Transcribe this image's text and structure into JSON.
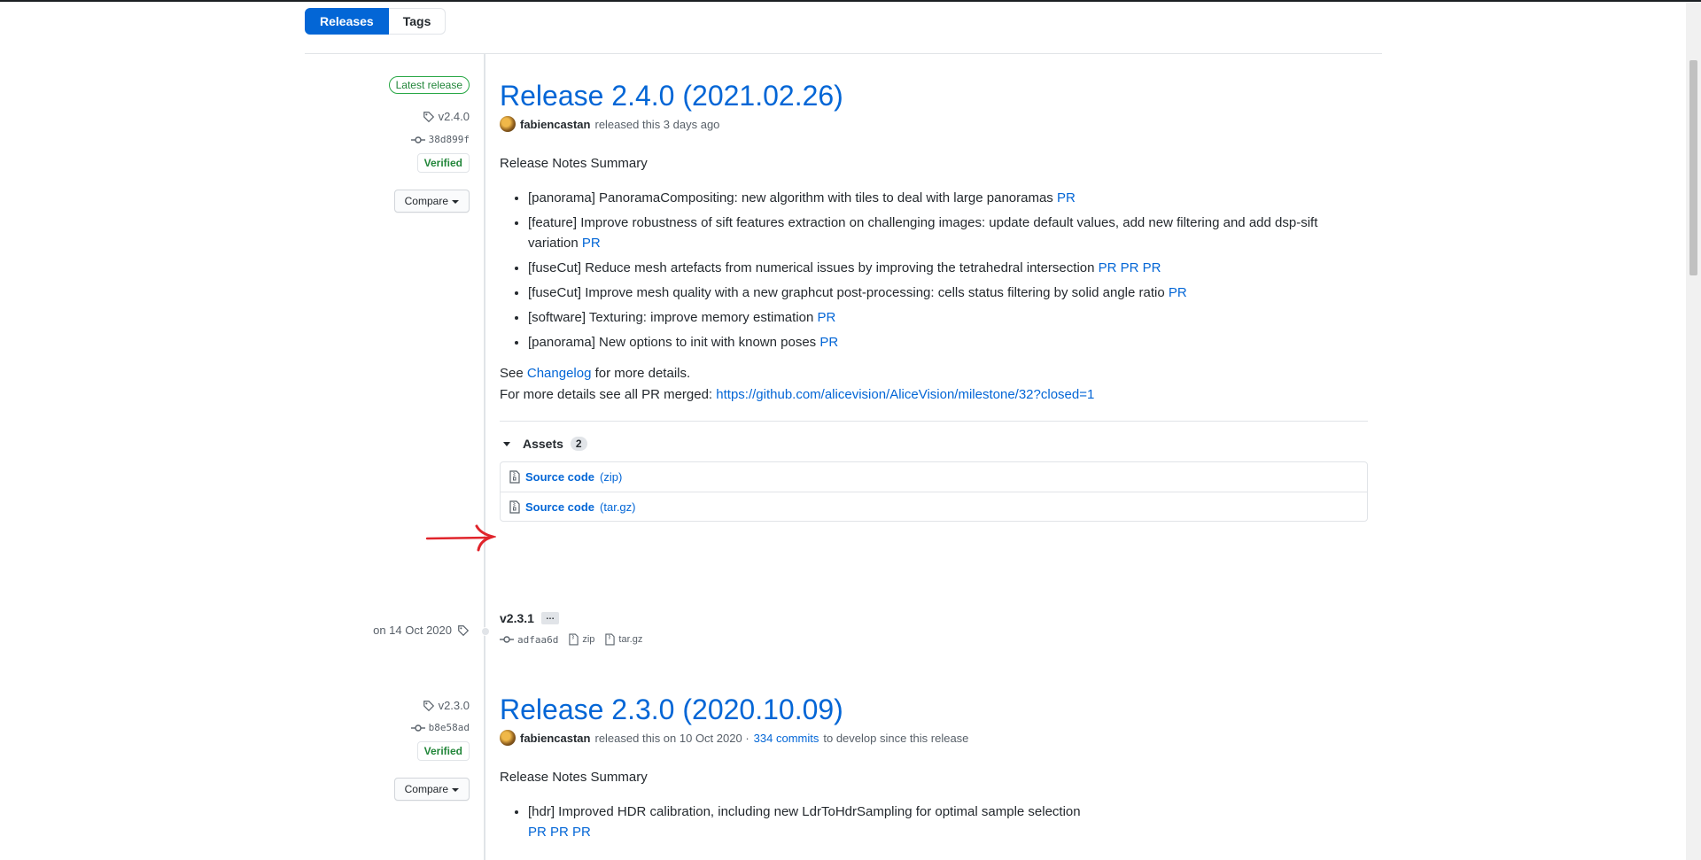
{
  "tabs": {
    "releases": "Releases",
    "tags": "Tags"
  },
  "release1": {
    "latest_badge": "Latest release",
    "tag": "v2.4.0",
    "commit": "38d899f",
    "verified": "Verified",
    "compare": "Compare",
    "title": "Release 2.4.0 (2021.02.26)",
    "author": "fabiencastan",
    "released_text": "released this 3 days ago",
    "summary_heading": "Release Notes Summary",
    "items": [
      {
        "text": "[panorama] PanoramaCompositing: new algorithm with tiles to deal with large panoramas",
        "links": [
          "PR"
        ]
      },
      {
        "text": "[feature] Improve robustness of sift features extraction on challenging images: update default values, add new filtering and add dsp-sift variation",
        "links": [
          "PR"
        ]
      },
      {
        "text": "[fuseCut] Reduce mesh artefacts from numerical issues by improving the tetrahedral intersection",
        "links": [
          "PR",
          "PR",
          "PR"
        ]
      },
      {
        "text": "[fuseCut] Improve mesh quality with a new graphcut post-processing: cells status filtering by solid angle ratio",
        "links": [
          "PR"
        ]
      },
      {
        "text": "[software] Texturing: improve memory estimation",
        "links": [
          "PR"
        ]
      },
      {
        "text": "[panorama] New options to init with known poses",
        "links": [
          "PR"
        ]
      }
    ],
    "see_prefix": "See",
    "changelog": "Changelog",
    "see_suffix": "for more details.",
    "more_prefix": "For more details see all PR merged:",
    "milestone_url": "https://github.com/alicevision/AliceVision/milestone/32?closed=1",
    "assets_label": "Assets",
    "assets_count": "2",
    "assets": [
      {
        "name": "Source code",
        "ext": "(zip)"
      },
      {
        "name": "Source code",
        "ext": "(tar.gz)"
      }
    ]
  },
  "tag_entry": {
    "date": "on 14 Oct 2020",
    "name": "v2.3.1",
    "ellipsis": "…",
    "commit": "adfaa6d",
    "zip": "zip",
    "targz": "tar.gz"
  },
  "release2": {
    "tag": "v2.3.0",
    "commit": "b8e58ad",
    "verified": "Verified",
    "compare": "Compare",
    "title": "Release 2.3.0 (2020.10.09)",
    "author": "fabiencastan",
    "released_text": "released this on 10 Oct 2020 ·",
    "commits_link": "334 commits",
    "commits_suffix": "to develop since this release",
    "summary_heading": "Release Notes Summary",
    "items": [
      {
        "text": "[hdr] Improved HDR calibration, including new LdrToHdrSampling for optimal sample selection",
        "links": [
          "PR",
          "PR",
          "PR"
        ]
      }
    ]
  },
  "colors": {
    "link": "#0366d6",
    "verified": "#22863a",
    "annotation_arrow": "#e0242b"
  }
}
